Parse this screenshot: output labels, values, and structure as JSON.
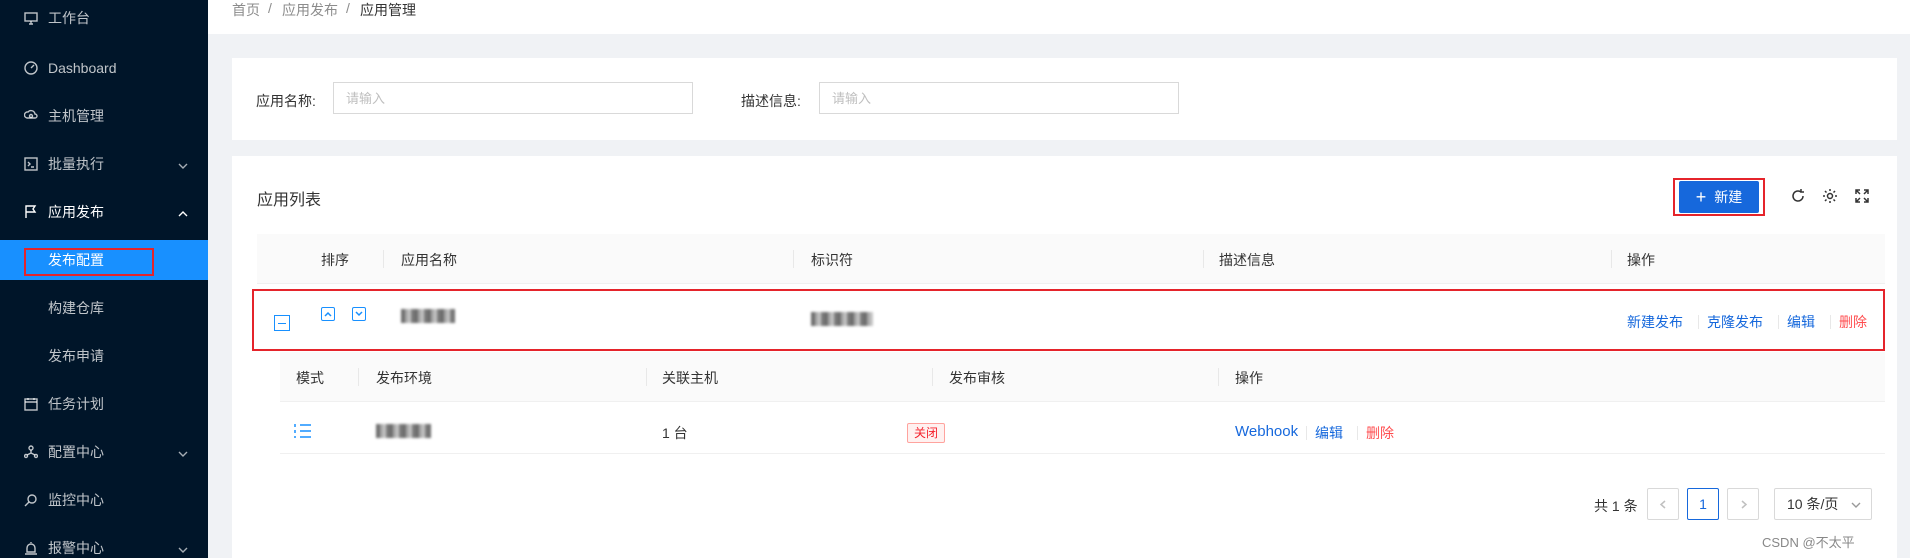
{
  "sidebar": {
    "items": [
      {
        "label": "工作台",
        "icon": "desktop-icon"
      },
      {
        "label": "Dashboard",
        "icon": "dashboard-icon"
      },
      {
        "label": "主机管理",
        "icon": "cloud-server-icon"
      },
      {
        "label": "批量执行",
        "icon": "terminal-icon"
      },
      {
        "label": "应用发布",
        "icon": "flag-icon"
      },
      {
        "label": "发布配置"
      },
      {
        "label": "构建仓库"
      },
      {
        "label": "发布申请"
      },
      {
        "label": "任务计划",
        "icon": "schedule-icon"
      },
      {
        "label": "配置中心",
        "icon": "deployment-icon"
      },
      {
        "label": "监控中心",
        "icon": "monitor-icon"
      },
      {
        "label": "报警中心",
        "icon": "alert-icon"
      }
    ]
  },
  "breadcrumb": {
    "home": "首页",
    "sep": "/",
    "section": "应用发布",
    "current": "应用管理"
  },
  "search": {
    "name_label": "应用名称:",
    "name_placeholder": "请输入",
    "desc_label": "描述信息:",
    "desc_placeholder": "请输入"
  },
  "table": {
    "title": "应用列表",
    "new_button": "新建",
    "columns": [
      "排序",
      "应用名称",
      "标识符",
      "描述信息",
      "操作"
    ],
    "row_actions": [
      "新建发布",
      "克隆发布",
      "编辑",
      "删除"
    ],
    "sub_columns": [
      "模式",
      "发布环境",
      "关联主机",
      "发布审核",
      "操作"
    ],
    "sub_row": {
      "hosts": "1 台",
      "review": "关闭",
      "actions": [
        "Webhook",
        "编辑",
        "删除"
      ]
    }
  },
  "pagination": {
    "total": "共 1 条",
    "current_page": "1",
    "page_size": "10 条/页"
  },
  "watermark": "CSDN @不太平",
  "colors": {
    "sidebar_bg": "#001529",
    "primary": "#1668dc",
    "active_menu": "#1890ff",
    "danger": "#ff4d4f",
    "highlight_box": "#e5242b"
  }
}
